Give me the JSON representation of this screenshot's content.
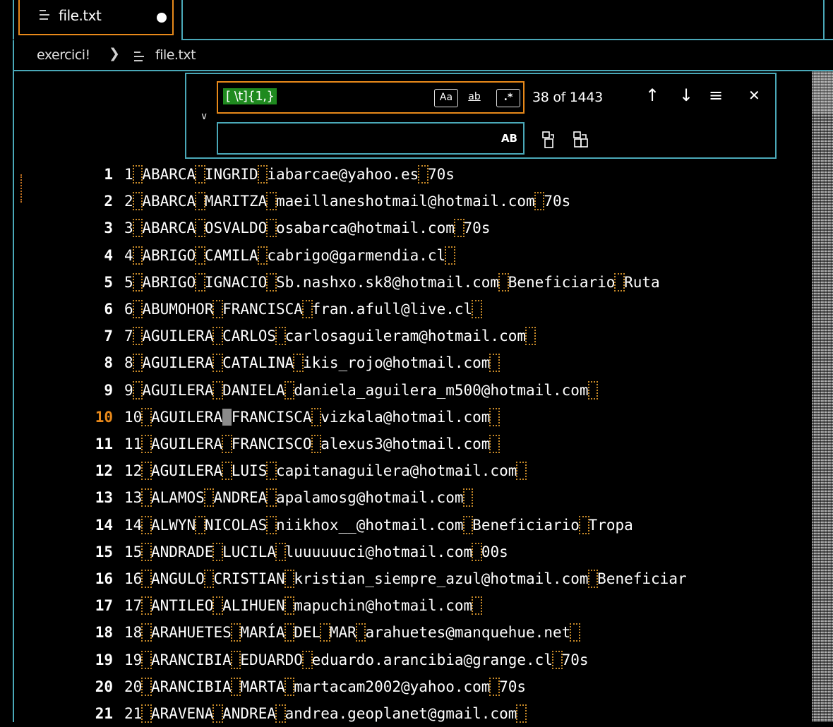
{
  "tab": {
    "name": "file.txt",
    "dirty": true
  },
  "breadcrumb": {
    "folder": "exercici!",
    "separator": "❯",
    "file": "file.txt"
  },
  "find": {
    "query": "[ \\t]{1,}",
    "match_case_label": "Aa",
    "whole_word_label": "ab",
    "regex_label": ".*",
    "count": "38 of 1443",
    "prev_glyph": "↑",
    "next_glyph": "↓",
    "selection_glyph": "≡",
    "close_glyph": "✕",
    "expand_glyph": "∨",
    "replace_value": "",
    "preserve_case_label": "AB"
  },
  "lines": [
    {
      "n": "1",
      "t": "1 ABARCA INGRID iabarcae@yahoo.es 70s"
    },
    {
      "n": "2",
      "t": "2 ABARCA MARITZA maeillaneshotmail@hotmail.com 70s"
    },
    {
      "n": "3",
      "t": "3 ABARCA OSVALDO osabarca@hotmail.com 70s"
    },
    {
      "n": "4",
      "t": "4 ABRIGO CAMILA cabrigo@garmendia.cl "
    },
    {
      "n": "5",
      "t": "5 ABRIGO IGNACIO Sb.nashxo.sk8@hotmail.com Beneficiario Ruta"
    },
    {
      "n": "6",
      "t": "6 ABUMOHOR FRANCISCA fran.afull@live.cl "
    },
    {
      "n": "7",
      "t": "7 AGUILERA CARLOS carlosaguileram@hotmail.com "
    },
    {
      "n": "8",
      "t": "8 AGUILERA CATALINA ikis_rojo@hotmail.com "
    },
    {
      "n": "9",
      "t": "9 AGUILERA DANIELA daniela_aguilera_m500@hotmail.com "
    },
    {
      "n": "10",
      "t": "10 AGUILERA FRANCISCA vizkala@hotmail.com "
    },
    {
      "n": "11",
      "t": "11 AGUILERA FRANCISCO alexus3@hotmail.com "
    },
    {
      "n": "12",
      "t": "12 AGUILERA LUIS capitanaguilera@hotmail.com "
    },
    {
      "n": "13",
      "t": "13 ALAMOS ANDREA apalamosg@hotmail.com "
    },
    {
      "n": "14",
      "t": "14 ALWYN NICOLAS niikhox__@hotmail.com Beneficiario Tropa"
    },
    {
      "n": "15",
      "t": "15 ANDRADE LUCILA luuuuuuci@hotmail.com 00s"
    },
    {
      "n": "16",
      "t": "16 ANGULO CRISTIAN kristian_siempre_azul@hotmail.com Beneficiar"
    },
    {
      "n": "17",
      "t": "17 ANTILEO ALIHUEN mapuchin@hotmail.com "
    },
    {
      "n": "18",
      "t": "18 ARAHUETES MARÍA DEL MAR arahuetes@manquehue.net "
    },
    {
      "n": "19",
      "t": "19 ARANCIBIA EDUARDO eduardo.arancibia@grange.cl 70s"
    },
    {
      "n": "20",
      "t": "20 ARANCIBIA MARTA martacam2002@yahoo.com 70s"
    },
    {
      "n": "21",
      "t": "21 ARAVENA ANDREA andrea.geoplanet@gmail.com "
    }
  ],
  "active_line": "10",
  "colors": {
    "accent_border": "#4aa8b8",
    "focus_orange": "#e8891a",
    "match_green": "#1f8a1f"
  }
}
